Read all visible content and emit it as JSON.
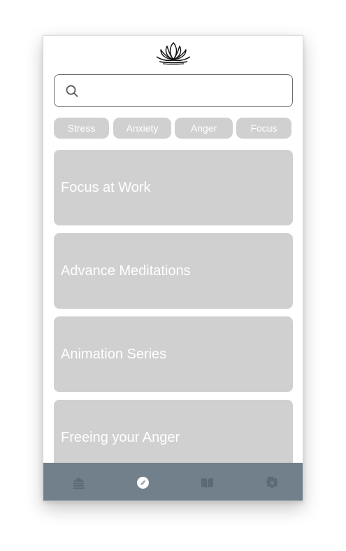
{
  "app": {
    "logo_icon": "lotus-icon"
  },
  "search": {
    "icon": "search-icon",
    "placeholder": "",
    "value": ""
  },
  "filters": [
    {
      "label": "Stress"
    },
    {
      "label": "Anxiety"
    },
    {
      "label": "Anger"
    },
    {
      "label": "Focus"
    }
  ],
  "cards": [
    {
      "title": "Focus at Work"
    },
    {
      "title": "Advance Meditations"
    },
    {
      "title": "Animation Series"
    },
    {
      "title": "Freeing your Anger"
    }
  ],
  "tabbar": {
    "items": [
      {
        "icon": "home-icon",
        "active": false
      },
      {
        "icon": "compass-icon",
        "active": true
      },
      {
        "icon": "book-icon",
        "active": false
      },
      {
        "icon": "gear-icon",
        "active": false
      }
    ]
  },
  "colors": {
    "card_bg": "#d0d0d0",
    "chip_bg": "#d0d0d0",
    "tabbar_bg": "#72808b",
    "tab_icon_inactive": "#5c6a74",
    "tab_icon_active": "#ffffff"
  }
}
